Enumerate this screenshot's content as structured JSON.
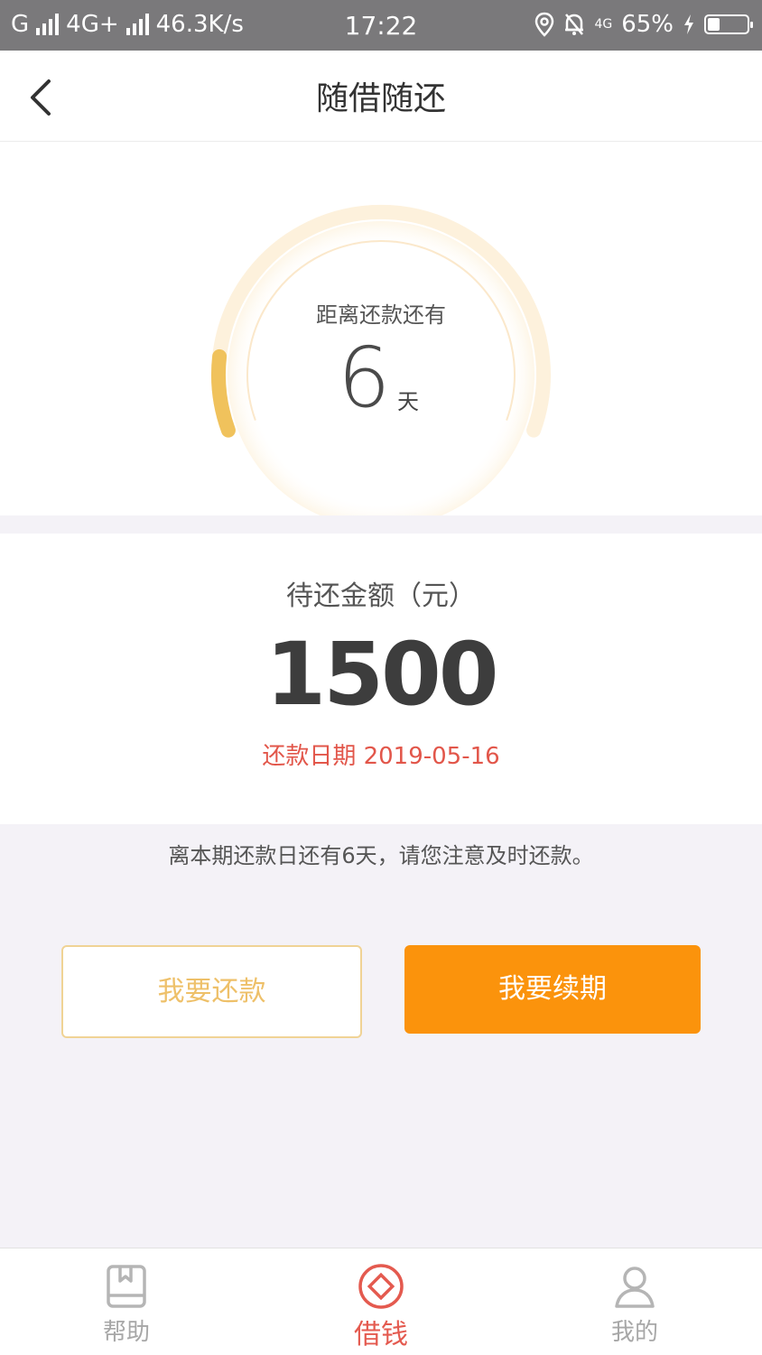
{
  "status_bar": {
    "carrier": "G",
    "network": "4G+",
    "speed": "46.3K/s",
    "time": "17:22",
    "net_badge": "4G",
    "battery": "65%",
    "battery_level": 0.65
  },
  "header": {
    "title": "随借随还",
    "back_icon": "chevron-left-icon"
  },
  "countdown": {
    "label": "距离还款还有",
    "value": "6",
    "unit": "天",
    "progress_fraction": 0.12,
    "track_color": "#fdf1dc",
    "progress_color": "#f0c25c"
  },
  "amount": {
    "label": "待还金额（元）",
    "value": "1500",
    "due_date": "还款日期 2019-05-16",
    "due_color": "#e2564a"
  },
  "notice": "离本期还款日还有6天，请您注意及时还款。",
  "buttons": {
    "repay": "我要还款",
    "renew": "我要续期",
    "renew_color": "#fb930c"
  },
  "tabs": [
    {
      "label": "帮助",
      "icon": "book-icon"
    },
    {
      "label": "借钱",
      "icon": "diamond-circle-icon"
    },
    {
      "label": "我的",
      "icon": "person-icon"
    }
  ]
}
